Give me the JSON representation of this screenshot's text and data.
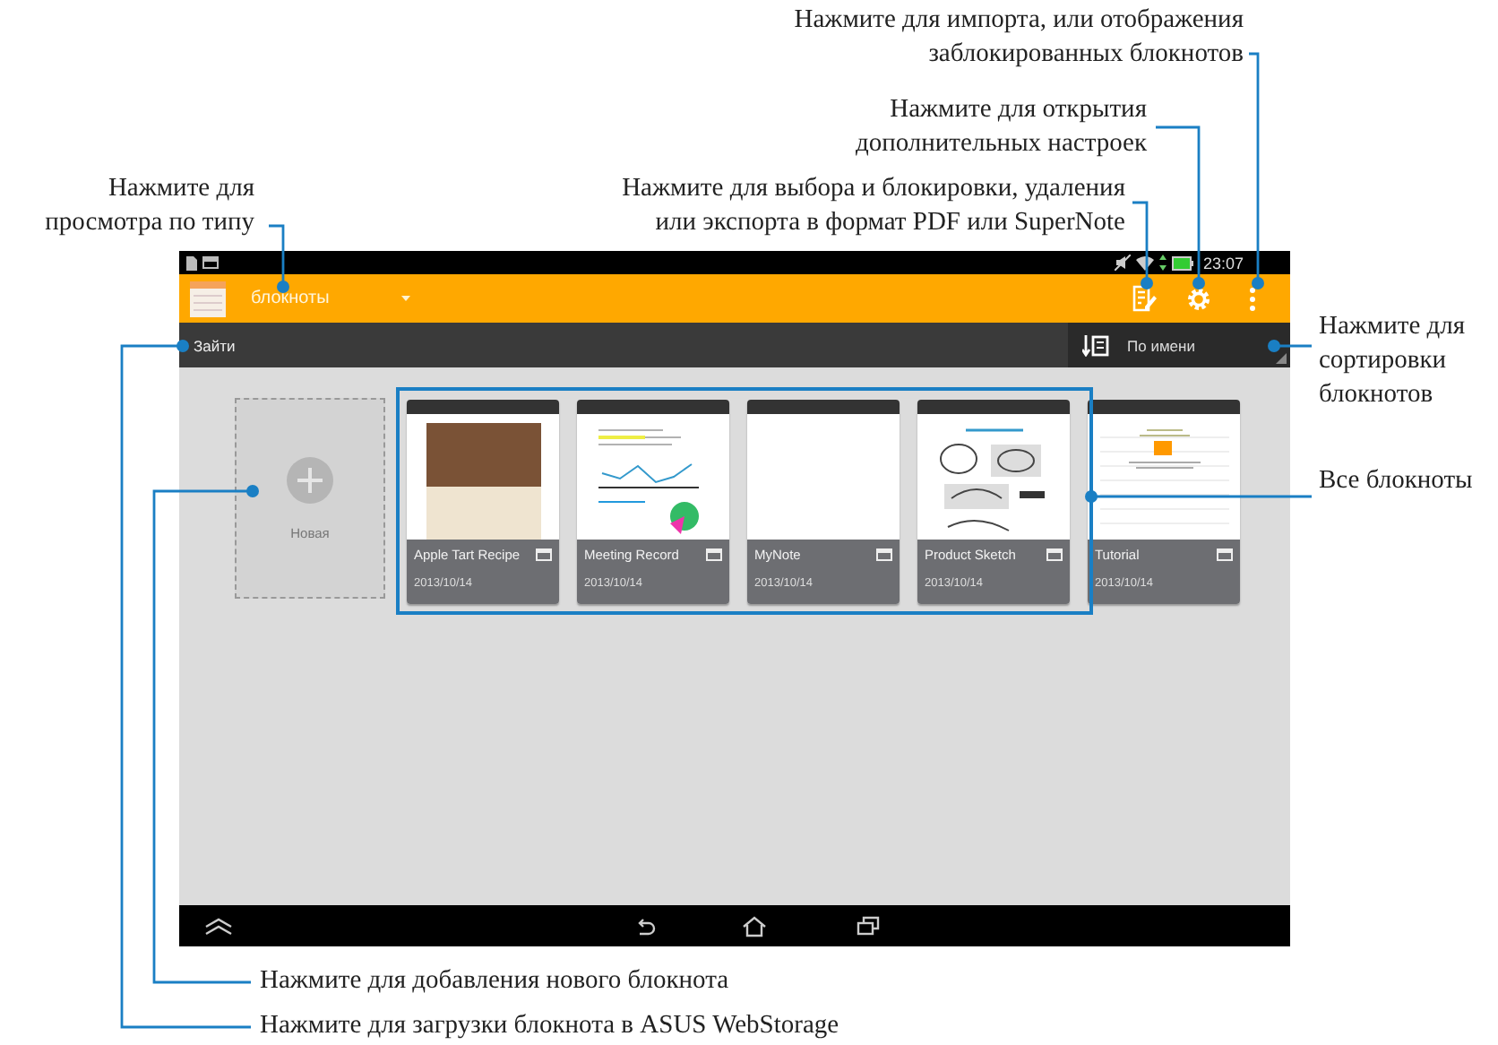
{
  "status_bar": {
    "time": "23:07"
  },
  "action_bar": {
    "view_selector": "блокноты"
  },
  "sub_bar": {
    "login_button": "Зайти",
    "sort_label": "По имени"
  },
  "new_notebook": {
    "label": "Новая"
  },
  "notebooks": [
    {
      "title": "Apple Tart Recipe",
      "date": "2013/10/14",
      "kind": "photo"
    },
    {
      "title": "Meeting Record",
      "date": "2013/10/14",
      "kind": "chart"
    },
    {
      "title": "MyNote",
      "date": "2013/10/14",
      "kind": "blank"
    },
    {
      "title": "Product Sketch",
      "date": "2013/10/14",
      "kind": "sketch"
    },
    {
      "title": "Tutorial",
      "date": "2013/10/14",
      "kind": "lined"
    }
  ],
  "callouts": [
    {
      "lines": [
        "Нажмите для импорта, или отображения",
        "заблокированных блокнотов"
      ]
    },
    {
      "lines": [
        "Нажмите для открытия",
        "дополнительных настроек"
      ]
    },
    {
      "lines": [
        "Нажмите для",
        "просмотра по типу"
      ]
    },
    {
      "lines": [
        "Нажмите для выбора и блокировки, удаления",
        "или экспорта в формат PDF или SuperNote"
      ]
    },
    {
      "lines": [
        "Нажмите для",
        "сортировки",
        "блокнотов"
      ]
    },
    {
      "lines": [
        "Все блокноты"
      ]
    },
    {
      "lines": [
        "Нажмите для добавления нового блокнота"
      ]
    },
    {
      "lines": [
        "Нажмите для загрузки блокнота в ASUS WebStorage"
      ]
    }
  ]
}
